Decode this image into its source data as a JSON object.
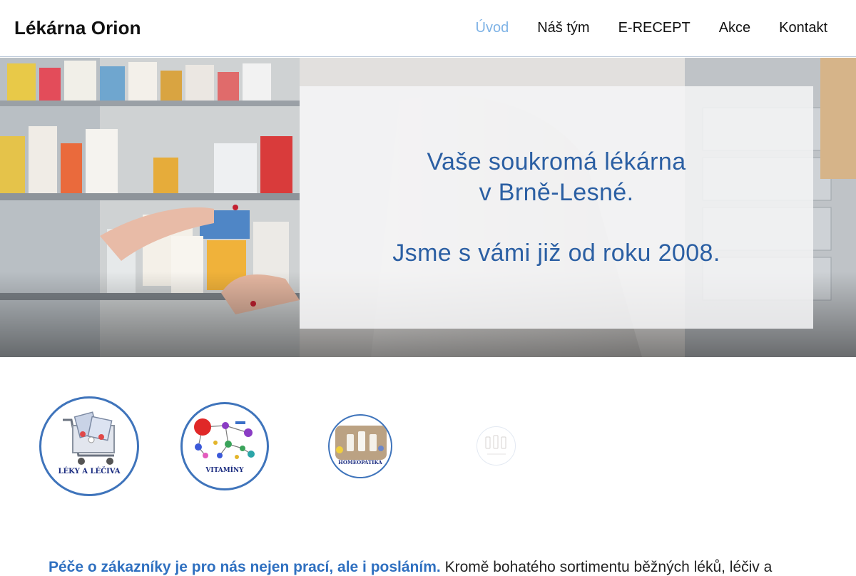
{
  "header": {
    "brand": "Lékárna Orion",
    "nav": [
      {
        "label": "Úvod",
        "active": true
      },
      {
        "label": "Náš tým",
        "active": false
      },
      {
        "label": "E-RECEPT",
        "active": false
      },
      {
        "label": "Akce",
        "active": false
      },
      {
        "label": "Kontakt",
        "active": false
      }
    ]
  },
  "hero": {
    "line1": "Vaše soukromá lékárna",
    "line2": "v Brně-Lesné.",
    "line3": "Jsme s vámi již od roku 2008."
  },
  "categories": [
    {
      "label": "LÉKY A LÉČIVA",
      "icon": "shopping-cart-pills-icon"
    },
    {
      "label": "VITAMÍNY",
      "icon": "vitamin-molecules-icon"
    },
    {
      "label": "HOMEOPATIKA",
      "icon": "homeopathy-bottles-icon"
    },
    {
      "label": "",
      "icon": "faded-category-icon"
    }
  ],
  "intro": {
    "highlight": "Péče o zákazníky je pro nás nejen prací, ale i posláním.",
    "text": " Kromě bohatého sortimentu běžných léků, léčiv a"
  },
  "colors": {
    "accent": "#2b5fa3",
    "nav_active": "#7fb3e6",
    "circle_border": "#3f74bb"
  }
}
